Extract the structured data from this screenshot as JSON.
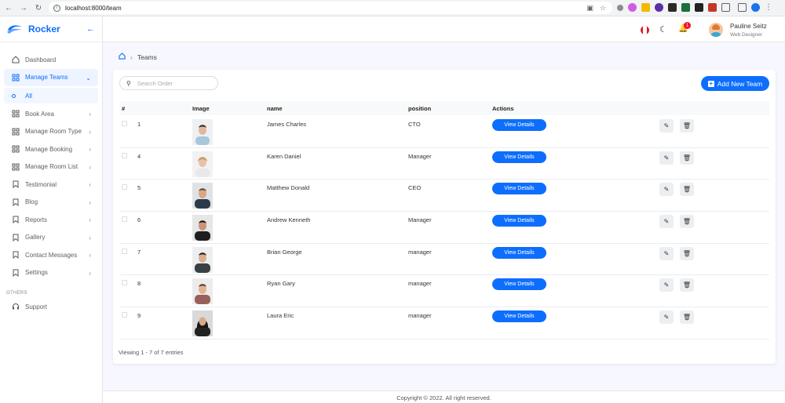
{
  "browser": {
    "url": "localhost:8000/team"
  },
  "brand": {
    "name": "Rocker",
    "accent": "#0d6efd"
  },
  "sidebar": {
    "items": [
      {
        "label": "Dashboard",
        "icon": "home-icon"
      },
      {
        "label": "Manage Teams",
        "icon": "grid-icon",
        "active": true
      },
      {
        "label": "Book Area",
        "icon": "grid-icon"
      },
      {
        "label": "Manage Room Type",
        "icon": "grid-icon"
      },
      {
        "label": "Manage Booking",
        "icon": "grid-icon"
      },
      {
        "label": "Manage Room List",
        "icon": "grid-icon"
      },
      {
        "label": "Testimonial",
        "icon": "bookmark-icon"
      },
      {
        "label": "Blog",
        "icon": "bookmark-icon"
      },
      {
        "label": "Reports",
        "icon": "bookmark-icon"
      },
      {
        "label": "Gallery",
        "icon": "bookmark-icon"
      },
      {
        "label": "Contact Messages",
        "icon": "bookmark-icon"
      },
      {
        "label": "Settings",
        "icon": "bookmark-icon"
      }
    ],
    "sub_item": "All",
    "section_label": "OTHERS",
    "support": "Support"
  },
  "header": {
    "notification_count": "1",
    "user_name": "Pauline Seitz",
    "user_role": "Web Designer"
  },
  "breadcrumb": {
    "current": "Teams"
  },
  "toolbar": {
    "search_placeholder": "Search Order",
    "add_label": "Add New Team"
  },
  "table": {
    "columns": [
      "#",
      "Image",
      "name",
      "position",
      "Actions"
    ],
    "view_label": "View Details",
    "rows": [
      {
        "id": "1",
        "name": "James Charles",
        "position": "CTO"
      },
      {
        "id": "4",
        "name": "Karen Daniel",
        "position": "Manager"
      },
      {
        "id": "5",
        "name": "Matthew Donald",
        "position": "CEO"
      },
      {
        "id": "6",
        "name": "Andrew Kenneth",
        "position": "Manager"
      },
      {
        "id": "7",
        "name": "Brian George",
        "position": "manager"
      },
      {
        "id": "8",
        "name": "Ryan Gary",
        "position": "manager"
      },
      {
        "id": "9",
        "name": "Laura Eric",
        "position": "manager"
      }
    ]
  },
  "footer": {
    "entries": "Viewing 1 - 7 of 7 entries",
    "copyright": "Copyright © 2022. All right reserved."
  }
}
